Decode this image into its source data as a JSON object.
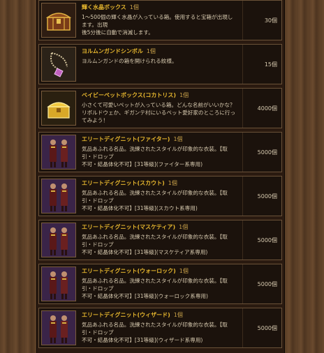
{
  "items": [
    {
      "title": "輝く水晶ボックス",
      "qty": "1個",
      "desc_lines": [
        "1～500個の輝く水晶が入っている箱。使用すると宝箱が出現します。出現",
        "後5分後に自動で消滅します。"
      ],
      "price": "30個",
      "icon": "treasure-chest-icon"
    },
    {
      "title": "ヨルムンガンドシンボル",
      "qty": "1個",
      "desc_lines": [
        "ヨルムンガンドの箱を開けられる紋様。"
      ],
      "price": "15個",
      "icon": "pendant-necklace-icon"
    },
    {
      "title": "ベイビーペットボックス(コカトリス)",
      "qty": "1個",
      "desc_lines": [
        "小さくて可愛いペットが入っている箱。どんな名前がいいかな？",
        "リボルドウェか、ギガンテ村にいるペット愛好家のところに行ってみよう！"
      ],
      "price": "4000個",
      "icon": "gold-chest-icon"
    },
    {
      "title": "エリートディグニット(ファイター)",
      "qty": "1個",
      "desc_lines": [
        "気品あふれる名品。洗練されたスタイルが印象的な衣装。【取引・ドロップ",
        "不可・結晶体化不可】[31等級](ファイター系専用)"
      ],
      "price": "5000個",
      "icon": "costume-figures-icon"
    },
    {
      "title": "エリートディグニット(スカウト)",
      "qty": "1個",
      "desc_lines": [
        "気品あふれる名品。洗練されたスタイルが印象的な衣装。【取引・ドロップ",
        "不可・結晶体化不可】[31等級](スカウト系専用)"
      ],
      "price": "5000個",
      "icon": "costume-figures-icon"
    },
    {
      "title": "エリートディグニット(マスケティア)",
      "qty": "1個",
      "desc_lines": [
        "気品あふれる名品。洗練されたスタイルが印象的な衣装。【取引・ドロップ",
        "不可・結晶体化不可】[31等級](マスケティア系専用)"
      ],
      "price": "5000個",
      "icon": "costume-figures-icon"
    },
    {
      "title": "エリートディグニット(ウォーロック)",
      "qty": "1個",
      "desc_lines": [
        "気品あふれる名品。洗練されたスタイルが印象的な衣装。【取引・ドロップ",
        "不可・結晶体化不可】[31等級](ウォーロック系専用)"
      ],
      "price": "5000個",
      "icon": "costume-figures-icon"
    },
    {
      "title": "エリートディグニット(ウィザード)",
      "qty": "1個",
      "desc_lines": [
        "気品あふれる名品。洗練されたスタイルが印象的な衣装。【取引・ドロップ",
        "不可・結晶体化不可】[31等級](ウィザード系専用)"
      ],
      "price": "5000個",
      "icon": "costume-figures-icon"
    }
  ]
}
